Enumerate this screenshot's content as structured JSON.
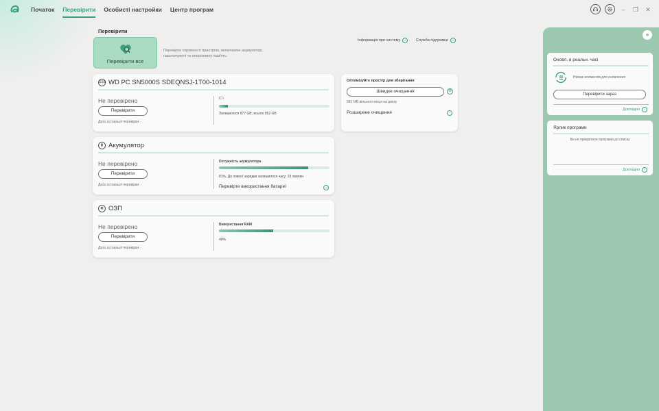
{
  "nav": {
    "items": [
      {
        "label": "Початок",
        "active": false
      },
      {
        "label": "Перевірити",
        "active": true
      },
      {
        "label": "Особисті настройки",
        "active": false
      },
      {
        "label": "Центр програм",
        "active": false
      }
    ]
  },
  "topicons": {
    "support": "headset-icon",
    "settings": "gear-icon"
  },
  "page": {
    "title": "Перевірити",
    "check_all_label": "Перевірити все",
    "description": "Перевірка справності пристрою, включаючи акумулятор, накопичувачі та оперативну пам'ять.",
    "link_sysinfo": "Інформація про систему",
    "link_support": "Служба підтримки"
  },
  "disk": {
    "name": "WD PC SN5000S SDEQNSJ-1T00-1014",
    "status": "Не перевірено",
    "check_label": "Перевірити",
    "last_check": "Дата останньої перевірки: -",
    "drive": "C:\\",
    "usage_fraction": 0.08,
    "remaining": "Залишилося 877 GB, всього 952 GB"
  },
  "battery": {
    "name": "Акумулятор",
    "status": "Не перевірено",
    "check_label": "Перевірити",
    "last_check": "Дата останньої перевірки: -",
    "capacity_label": "Потужність акумулятора",
    "level_fraction": 0.81,
    "info": "81%, До повної зарядки залишилося часу: 23 хвилин",
    "usage_link": "Перевірте використання батареї"
  },
  "ram": {
    "name": "ОЗП",
    "status": "Не перевірено",
    "check_label": "Перевірити",
    "last_check": "Дата останньої перевірки: -",
    "usage_label": "Використання RAM",
    "usage_fraction": 0.49,
    "percent": "49%"
  },
  "storage": {
    "title": "Оптимізуйте простір для зберігання",
    "quick_clean": "Швидке очищення",
    "free_space": "581 MB вільного місця на диску",
    "advanced": "Розширене очищення"
  },
  "right": {
    "updates": {
      "title": "Оновл. в реальн. часі",
      "empty": "Немає елементів для оновлення",
      "check_now": "Перевірити зараз",
      "more": "Докладно"
    },
    "shortcuts": {
      "title": "Ярлик програми",
      "empty": "Ви не прикріпили програми до списку",
      "more": "Докладно"
    }
  }
}
